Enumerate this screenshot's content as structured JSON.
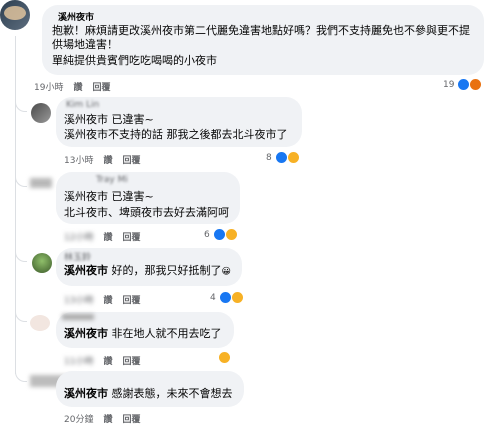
{
  "main_comment": {
    "author": "溪州夜市",
    "lines": [
      "抱歉！麻煩請更改溪州夜市第二代麗免違害地點好嗎？我們不支持麗免也不參與更不提",
      "供場地違害！",
      "單純提供貴賓們吃吃喝喝的小夜市"
    ],
    "time": "19小時",
    "like": "讚",
    "reply": "回覆",
    "reaction_count": "19"
  },
  "replies": [
    {
      "author": "Kim Lin",
      "lines": [
        "溪州夜市 已違害~",
        "溪州夜市不支持的話 那我之後都去北斗夜市了"
      ],
      "time": "13小時",
      "like": "讚",
      "reply": "回覆",
      "reaction_count": "8"
    },
    {
      "author": "Tray Mi",
      "lines": [
        "溪州夜市 已違害~",
        "北斗夜市、埤頭夜市去好去滿阿呵"
      ],
      "time": "12小時",
      "like": "讚",
      "reply": "回覆",
      "reaction_count": "6"
    },
    {
      "author": "林玉鈴",
      "name_tag": "溪州夜市",
      "text": " 好的，那我只好抵制了",
      "emoji": "😀",
      "time": "13小時",
      "like": "讚",
      "reply": "回覆",
      "reaction_count": "4"
    },
    {
      "author": "",
      "name_tag": "溪州夜市",
      "text": " 非在地人就不用去吃了",
      "time": "11小時",
      "like": "讚",
      "reply": "回覆"
    },
    {
      "author": "",
      "name_tag": "溪州夜市",
      "text": " 感謝表態，未來不會想去",
      "time": "20分鐘",
      "like": "讚",
      "reply": "回覆"
    }
  ],
  "colors": {
    "bubble": "#f0f2f5",
    "meta_text": "#65676b",
    "like_blue": "#1877f2",
    "haha_yellow": "#f7b125",
    "angry_orange": "#e9710f"
  },
  "icons": {
    "like": "like-reaction-icon",
    "haha": "haha-reaction-icon",
    "angry": "angry-reaction-icon"
  }
}
